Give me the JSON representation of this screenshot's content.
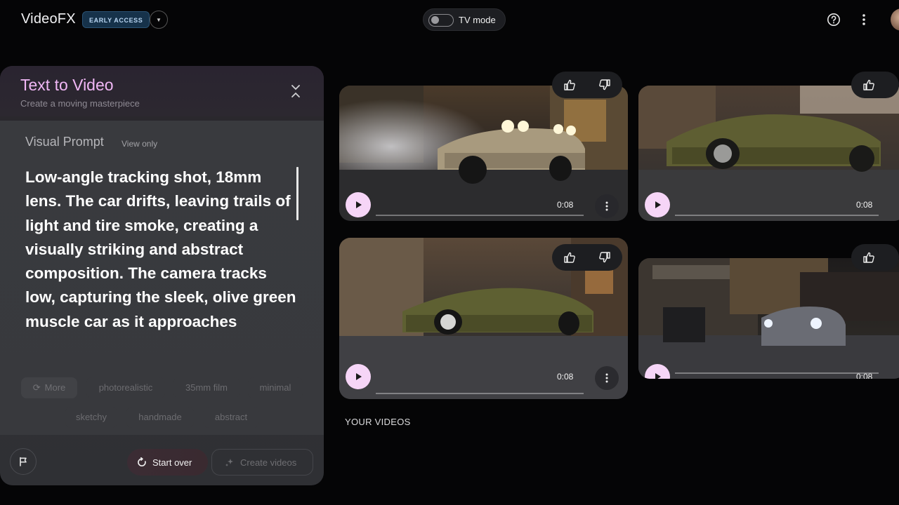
{
  "header": {
    "brand": "VideoFX",
    "badge": "EARLY ACCESS",
    "tv_mode_label": "TV mode",
    "icons": [
      "help-icon",
      "more-vert-icon",
      "user-avatar"
    ]
  },
  "panel": {
    "title": "Text to Video",
    "subtitle": "Create a moving masterpiece",
    "visual_prompt_label": "Visual Prompt",
    "view_only": "View only",
    "prompt_text": "Low-angle tracking shot, 18mm lens. The car drifts, leaving trails of light and tire smoke, creating a visually striking and abstract composition. The camera tracks low, capturing the sleek, olive green muscle car as it approaches",
    "chips": [
      "More",
      "photorealistic",
      "35mm film",
      "minimal",
      "sketchy",
      "handmade",
      "abstract"
    ],
    "start_over": "Start over",
    "create_videos": "Create videos"
  },
  "videos": {
    "section_label": "YOUR VIDEOS",
    "items": [
      {
        "duration": "0:08"
      },
      {
        "duration": "0:08"
      },
      {
        "duration": "0:08"
      },
      {
        "duration": "0:08"
      }
    ]
  },
  "colors": {
    "accent_pink": "#f0b7f5",
    "play_button": "#f6d5f7",
    "badge_bg": "#16324a"
  }
}
